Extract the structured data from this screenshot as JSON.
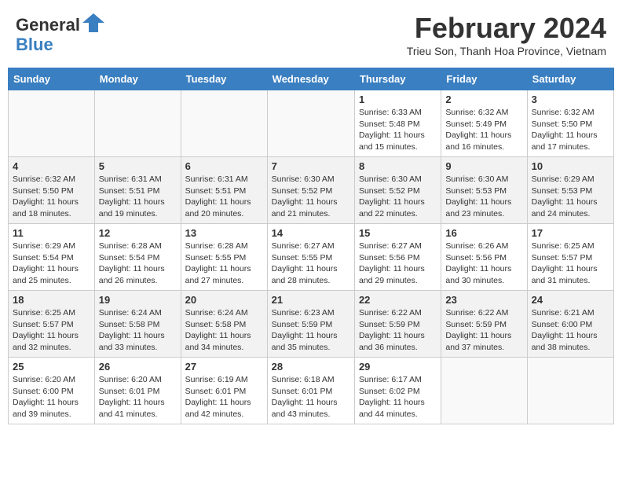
{
  "header": {
    "logo_line1": "General",
    "logo_line2": "Blue",
    "month_title": "February 2024",
    "location": "Trieu Son, Thanh Hoa Province, Vietnam"
  },
  "days_of_week": [
    "Sunday",
    "Monday",
    "Tuesday",
    "Wednesday",
    "Thursday",
    "Friday",
    "Saturday"
  ],
  "weeks": [
    [
      {
        "day": "",
        "info": ""
      },
      {
        "day": "",
        "info": ""
      },
      {
        "day": "",
        "info": ""
      },
      {
        "day": "",
        "info": ""
      },
      {
        "day": "1",
        "info": "Sunrise: 6:33 AM\nSunset: 5:48 PM\nDaylight: 11 hours and 15 minutes."
      },
      {
        "day": "2",
        "info": "Sunrise: 6:32 AM\nSunset: 5:49 PM\nDaylight: 11 hours and 16 minutes."
      },
      {
        "day": "3",
        "info": "Sunrise: 6:32 AM\nSunset: 5:50 PM\nDaylight: 11 hours and 17 minutes."
      }
    ],
    [
      {
        "day": "4",
        "info": "Sunrise: 6:32 AM\nSunset: 5:50 PM\nDaylight: 11 hours and 18 minutes."
      },
      {
        "day": "5",
        "info": "Sunrise: 6:31 AM\nSunset: 5:51 PM\nDaylight: 11 hours and 19 minutes."
      },
      {
        "day": "6",
        "info": "Sunrise: 6:31 AM\nSunset: 5:51 PM\nDaylight: 11 hours and 20 minutes."
      },
      {
        "day": "7",
        "info": "Sunrise: 6:30 AM\nSunset: 5:52 PM\nDaylight: 11 hours and 21 minutes."
      },
      {
        "day": "8",
        "info": "Sunrise: 6:30 AM\nSunset: 5:52 PM\nDaylight: 11 hours and 22 minutes."
      },
      {
        "day": "9",
        "info": "Sunrise: 6:30 AM\nSunset: 5:53 PM\nDaylight: 11 hours and 23 minutes."
      },
      {
        "day": "10",
        "info": "Sunrise: 6:29 AM\nSunset: 5:53 PM\nDaylight: 11 hours and 24 minutes."
      }
    ],
    [
      {
        "day": "11",
        "info": "Sunrise: 6:29 AM\nSunset: 5:54 PM\nDaylight: 11 hours and 25 minutes."
      },
      {
        "day": "12",
        "info": "Sunrise: 6:28 AM\nSunset: 5:54 PM\nDaylight: 11 hours and 26 minutes."
      },
      {
        "day": "13",
        "info": "Sunrise: 6:28 AM\nSunset: 5:55 PM\nDaylight: 11 hours and 27 minutes."
      },
      {
        "day": "14",
        "info": "Sunrise: 6:27 AM\nSunset: 5:55 PM\nDaylight: 11 hours and 28 minutes."
      },
      {
        "day": "15",
        "info": "Sunrise: 6:27 AM\nSunset: 5:56 PM\nDaylight: 11 hours and 29 minutes."
      },
      {
        "day": "16",
        "info": "Sunrise: 6:26 AM\nSunset: 5:56 PM\nDaylight: 11 hours and 30 minutes."
      },
      {
        "day": "17",
        "info": "Sunrise: 6:25 AM\nSunset: 5:57 PM\nDaylight: 11 hours and 31 minutes."
      }
    ],
    [
      {
        "day": "18",
        "info": "Sunrise: 6:25 AM\nSunset: 5:57 PM\nDaylight: 11 hours and 32 minutes."
      },
      {
        "day": "19",
        "info": "Sunrise: 6:24 AM\nSunset: 5:58 PM\nDaylight: 11 hours and 33 minutes."
      },
      {
        "day": "20",
        "info": "Sunrise: 6:24 AM\nSunset: 5:58 PM\nDaylight: 11 hours and 34 minutes."
      },
      {
        "day": "21",
        "info": "Sunrise: 6:23 AM\nSunset: 5:59 PM\nDaylight: 11 hours and 35 minutes."
      },
      {
        "day": "22",
        "info": "Sunrise: 6:22 AM\nSunset: 5:59 PM\nDaylight: 11 hours and 36 minutes."
      },
      {
        "day": "23",
        "info": "Sunrise: 6:22 AM\nSunset: 5:59 PM\nDaylight: 11 hours and 37 minutes."
      },
      {
        "day": "24",
        "info": "Sunrise: 6:21 AM\nSunset: 6:00 PM\nDaylight: 11 hours and 38 minutes."
      }
    ],
    [
      {
        "day": "25",
        "info": "Sunrise: 6:20 AM\nSunset: 6:00 PM\nDaylight: 11 hours and 39 minutes."
      },
      {
        "day": "26",
        "info": "Sunrise: 6:20 AM\nSunset: 6:01 PM\nDaylight: 11 hours and 41 minutes."
      },
      {
        "day": "27",
        "info": "Sunrise: 6:19 AM\nSunset: 6:01 PM\nDaylight: 11 hours and 42 minutes."
      },
      {
        "day": "28",
        "info": "Sunrise: 6:18 AM\nSunset: 6:01 PM\nDaylight: 11 hours and 43 minutes."
      },
      {
        "day": "29",
        "info": "Sunrise: 6:17 AM\nSunset: 6:02 PM\nDaylight: 11 hours and 44 minutes."
      },
      {
        "day": "",
        "info": ""
      },
      {
        "day": "",
        "info": ""
      }
    ]
  ]
}
